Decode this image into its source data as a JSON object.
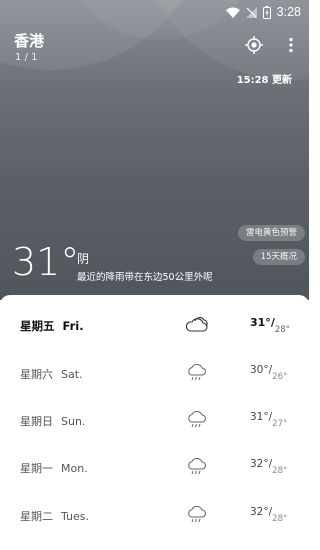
{
  "status_bar": {
    "time": "3:28"
  },
  "header": {
    "city": "香港",
    "page_indicator": "1 / 1",
    "updated": "15:28 更新"
  },
  "alerts": {
    "warning_pill": "雷电黄色预警",
    "trend_pill": "15天概况"
  },
  "current": {
    "temperature": "31°",
    "condition": "阴",
    "description": "最近的降雨带在东边50公里外呢"
  },
  "forecast": [
    {
      "day_cn": "星期五",
      "day_en": "Fri.",
      "icon": "cloudy-icon",
      "high": "31°",
      "low": "28°"
    },
    {
      "day_cn": "星期六",
      "day_en": "Sat.",
      "icon": "rain-icon",
      "high": "30°",
      "low": "26°"
    },
    {
      "day_cn": "星期日",
      "day_en": "Sun.",
      "icon": "rain-icon",
      "high": "31°",
      "low": "27°"
    },
    {
      "day_cn": "星期一",
      "day_en": "Mon.",
      "icon": "rain-icon",
      "high": "32°",
      "low": "28°"
    },
    {
      "day_cn": "星期二",
      "day_en": "Tues.",
      "icon": "rain-icon",
      "high": "32°",
      "low": "28°"
    }
  ],
  "colors": {
    "sky_top": "#8a8f95",
    "sky_bottom": "#4f565c",
    "sheet": "#ffffff"
  }
}
